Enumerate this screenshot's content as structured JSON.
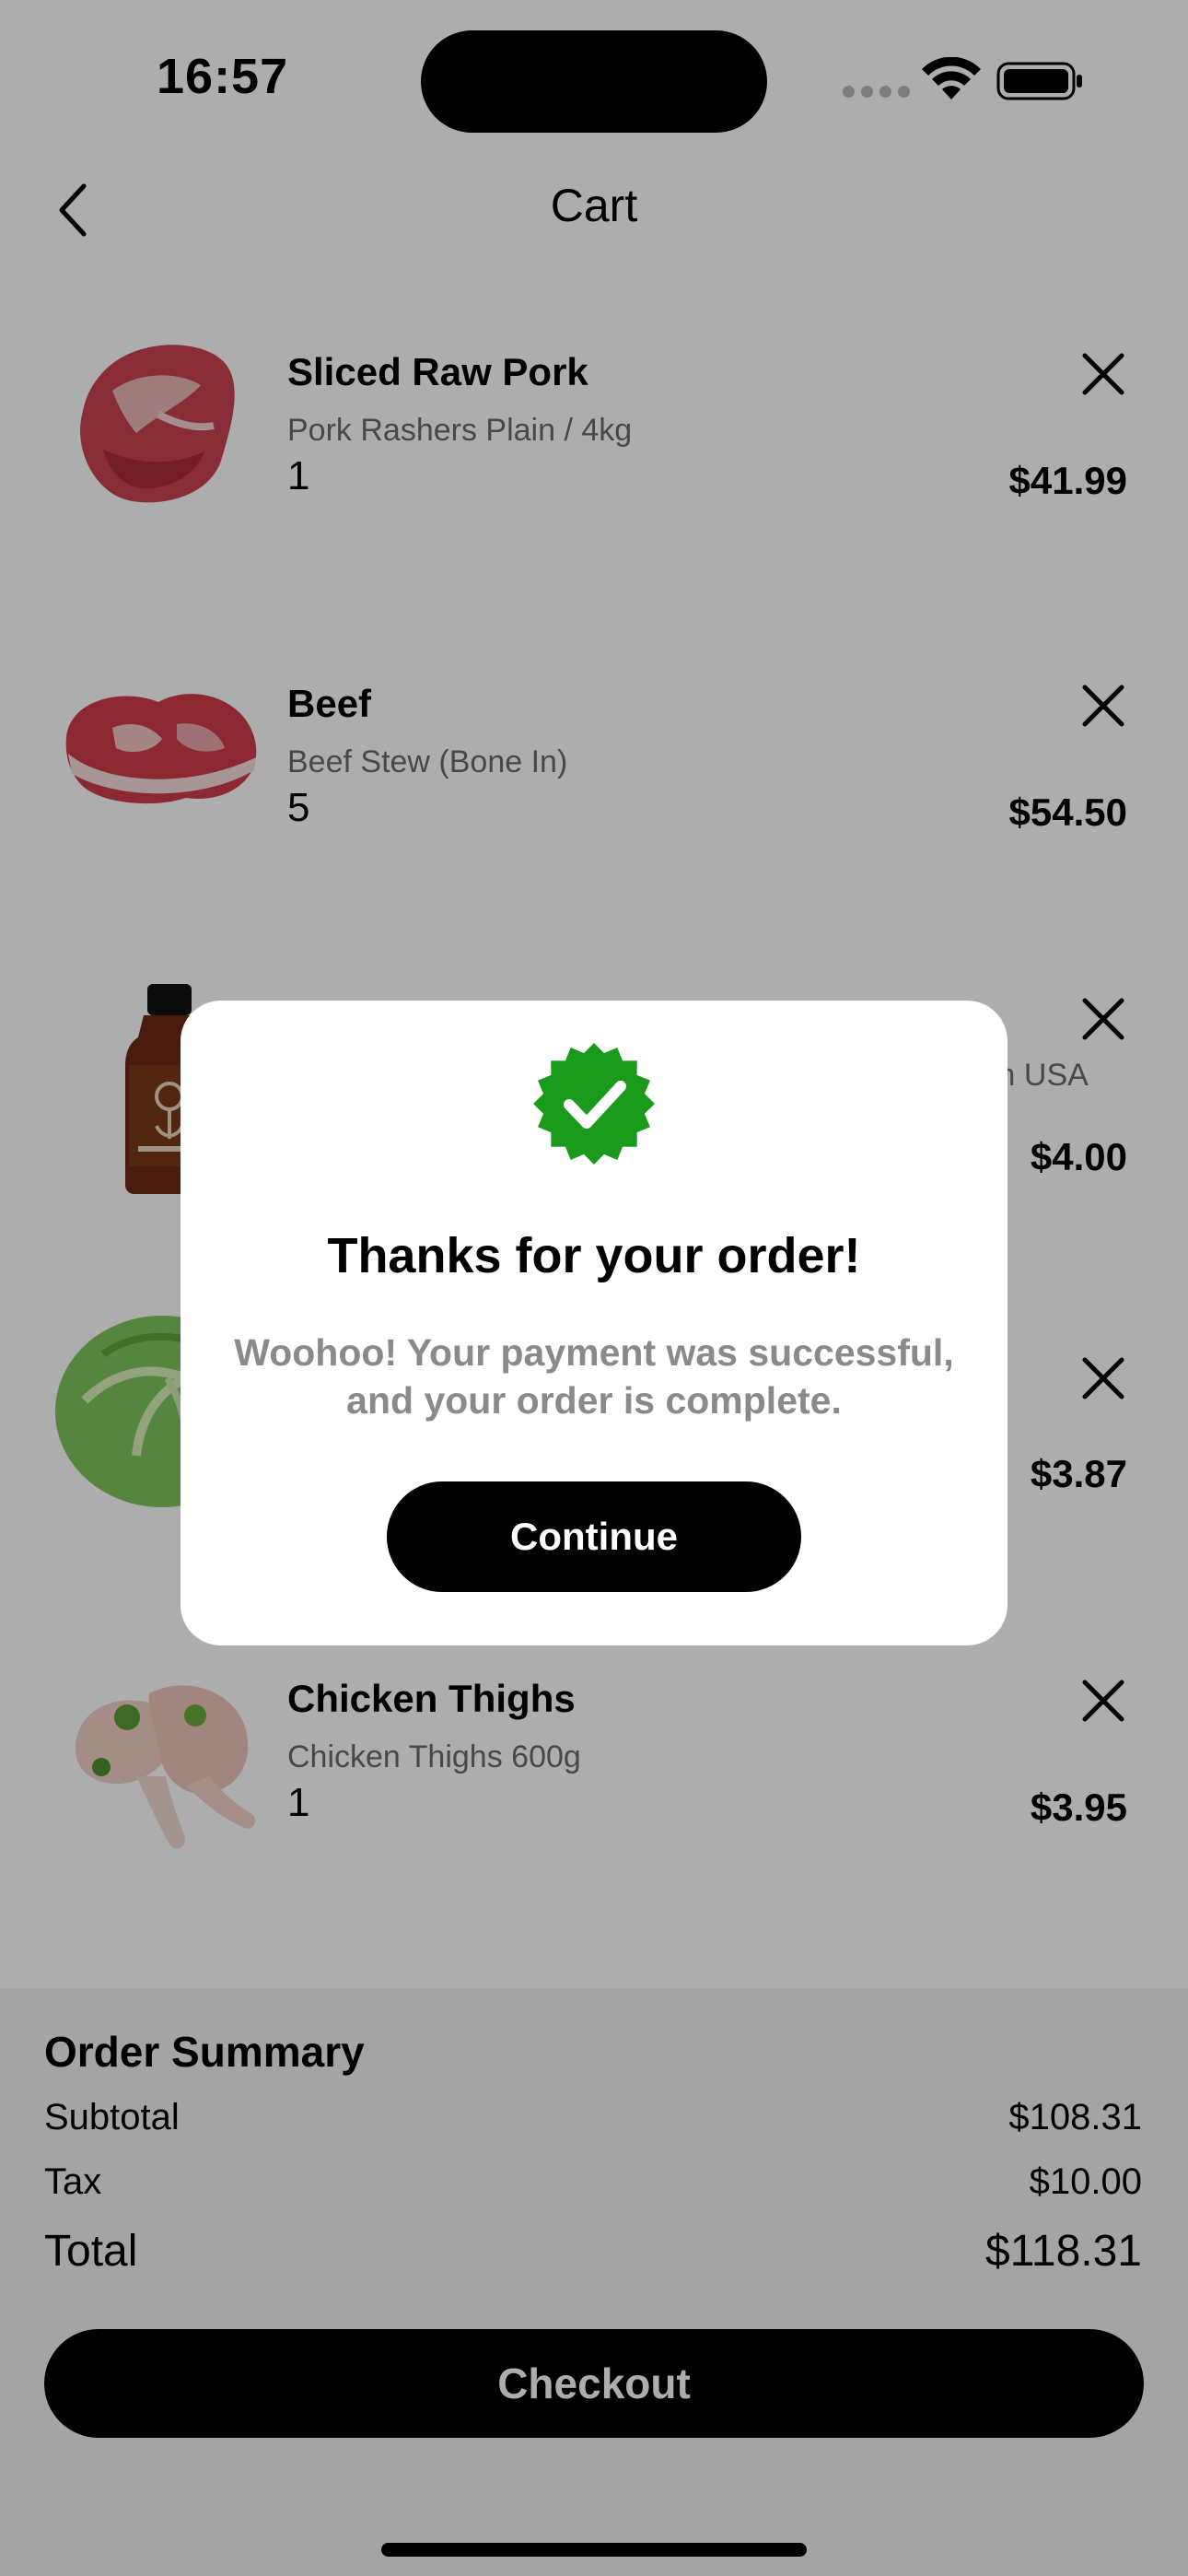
{
  "status_bar": {
    "time": "16:57"
  },
  "header": {
    "title": "Cart"
  },
  "cart": {
    "items": [
      {
        "name": "Sliced Raw Pork",
        "description": "Pork Rashers Plain / 4kg",
        "quantity": "1",
        "price": "$41.99",
        "image": "pork-image"
      },
      {
        "name": "Beef",
        "description": "Beef Stew (Bone In)",
        "quantity": "5",
        "price": "$54.50",
        "image": "beef-image"
      },
      {
        "name": "",
        "description": "in USA",
        "quantity": "",
        "price": "$4.00",
        "image": "sauce-bottle-image"
      },
      {
        "name": "",
        "description": "",
        "quantity": "",
        "price": "$3.87",
        "image": "cabbage-image"
      },
      {
        "name": "Chicken Thighs",
        "description": "Chicken Thighs 600g",
        "quantity": "1",
        "price": "$3.95",
        "image": "chicken-image"
      }
    ]
  },
  "summary": {
    "title": "Order Summary",
    "subtotal_label": "Subtotal",
    "subtotal_value": "$108.31",
    "tax_label": "Tax",
    "tax_value": "$10.00",
    "total_label": "Total",
    "total_value": "$118.31",
    "checkout_label": "Checkout"
  },
  "modal": {
    "title": "Thanks for your order!",
    "message": "Woohoo! Your payment was successful, and your order is complete.",
    "continue_label": "Continue",
    "badge_color": "#1a9a1a"
  }
}
